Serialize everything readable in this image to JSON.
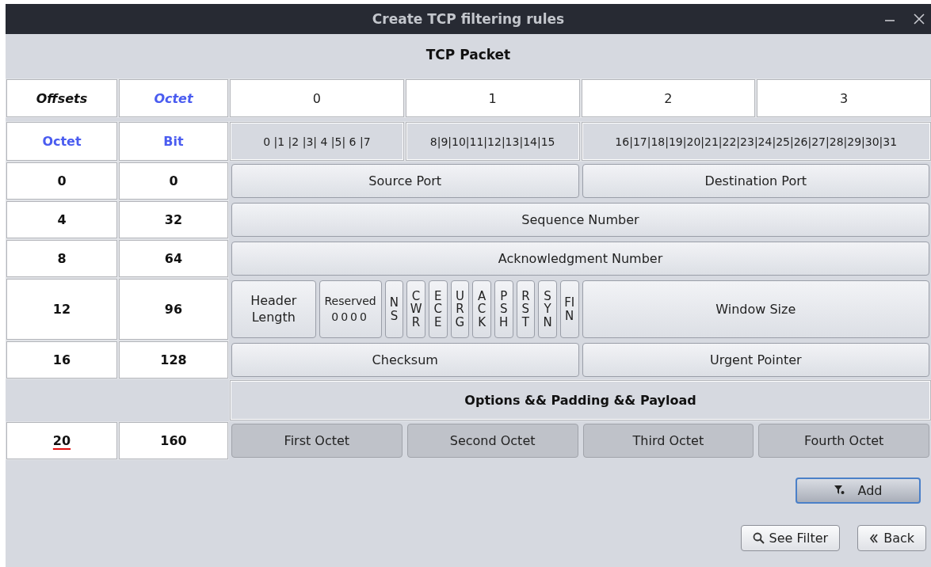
{
  "window": {
    "title": "Create TCP filtering rules"
  },
  "packet_title": "TCP Packet",
  "header": {
    "corner": "Offsets",
    "octet_label": "Octet",
    "octets": [
      "0",
      "1",
      "2",
      "3"
    ]
  },
  "bit_header": {
    "octet_label": "Octet",
    "bit_label": "Bit",
    "groups": [
      "0 |1 |2 |3| 4 |5| 6 |7",
      "8|9|10|11|12|13|14|15",
      "16|17|18|19|20|21|22|23|24|25|26|27|28|29|30|31"
    ]
  },
  "rows": [
    {
      "octet": "0",
      "bit": "0",
      "fields": [
        {
          "kind": "half",
          "label": "Source Port"
        },
        {
          "kind": "half",
          "label": "Destination Port"
        }
      ]
    },
    {
      "octet": "4",
      "bit": "32",
      "fields": [
        {
          "kind": "word",
          "label": "Sequence Number"
        }
      ]
    },
    {
      "octet": "8",
      "bit": "64",
      "fields": [
        {
          "kind": "word",
          "label": "Acknowledgment Number"
        }
      ]
    },
    {
      "octet": "12",
      "bit": "96",
      "fields": [
        {
          "kind": "nibble",
          "label": "Header Length"
        },
        {
          "kind": "reserved",
          "label": "Reserved",
          "value": "0000"
        },
        {
          "kind": "flag",
          "label": "NS"
        },
        {
          "kind": "flag",
          "label": "CWR"
        },
        {
          "kind": "flag",
          "label": "ECE"
        },
        {
          "kind": "flag",
          "label": "URG"
        },
        {
          "kind": "flag",
          "label": "ACK"
        },
        {
          "kind": "flag",
          "label": "PSH"
        },
        {
          "kind": "flag",
          "label": "RST"
        },
        {
          "kind": "flag",
          "label": "SYN"
        },
        {
          "kind": "flag",
          "label": "FIN"
        },
        {
          "kind": "half",
          "label": "Window Size"
        }
      ]
    },
    {
      "octet": "16",
      "bit": "128",
      "fields": [
        {
          "kind": "half",
          "label": "Checksum"
        },
        {
          "kind": "half",
          "label": "Urgent Pointer"
        }
      ]
    }
  ],
  "options": {
    "title": "Options && Padding && Payload",
    "octet": "20",
    "octet_error": true,
    "bit": "160",
    "octets": [
      "First Octet",
      "Second Octet",
      "Third Octet",
      "Fourth Octet"
    ]
  },
  "buttons": [
    {
      "kind": "add",
      "label": "Add",
      "focused": true
    },
    {
      "kind": "see_filter",
      "label": "See Filter",
      "focused": false
    },
    {
      "kind": "back",
      "label": "Back",
      "focused": false
    }
  ]
}
